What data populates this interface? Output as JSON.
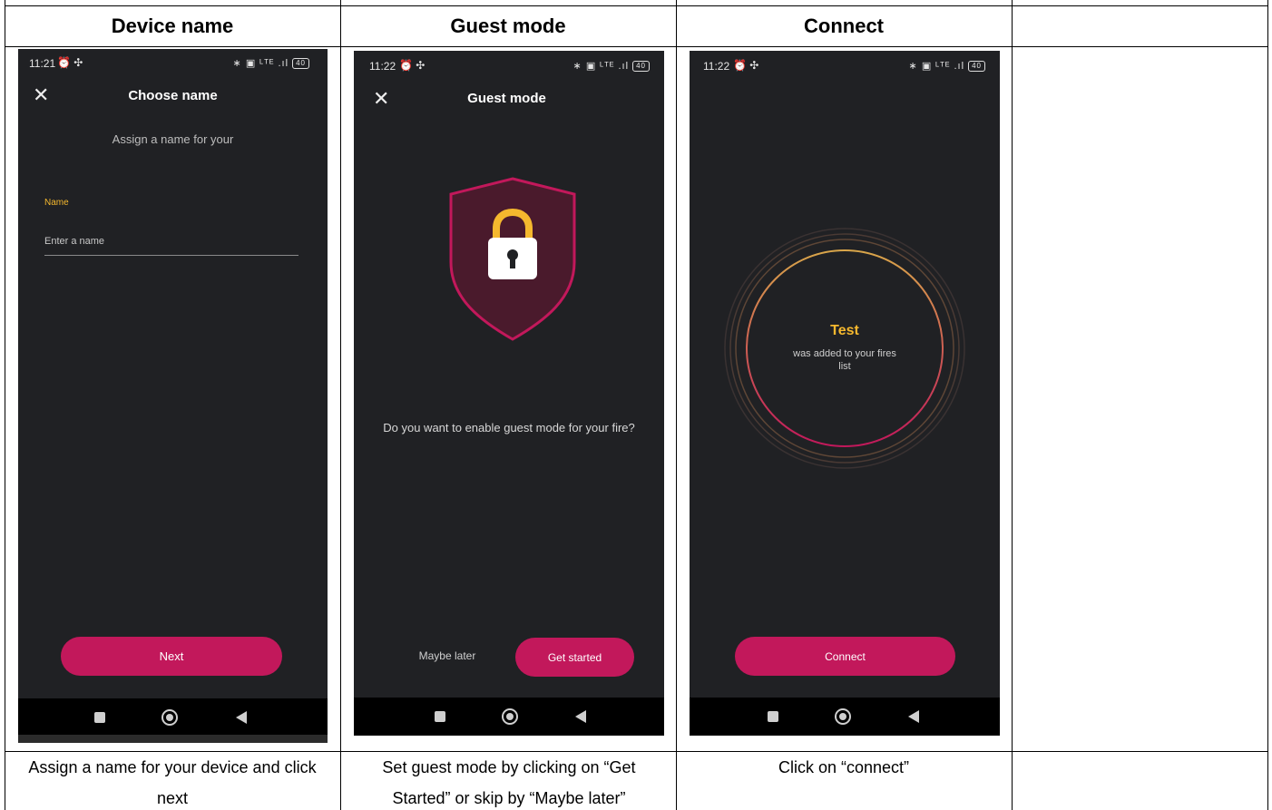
{
  "headers": [
    "Device name",
    "Guest mode",
    "Connect",
    ""
  ],
  "captions": [
    "Assign a name for your device and click next",
    "Set guest mode by clicking on “Get Started” or skip by “Maybe later”",
    "Click on “connect”",
    ""
  ],
  "screen1": {
    "time": "11:21",
    "title": "Choose name",
    "subtitle": "Assign a name for your",
    "field_label": "Name",
    "field_placeholder": "Enter a name",
    "next_label": "Next"
  },
  "screen2": {
    "time": "11:22",
    "title": "Guest mode",
    "question": "Do you want to enable guest mode for your fire?",
    "maybe_label": "Maybe later",
    "start_label": "Get started"
  },
  "screen3": {
    "time": "11:22",
    "device_name": "Test",
    "message": "was added to your fires list",
    "connect_label": "Connect"
  },
  "status": {
    "right_icons": "∗ ▣ ᴸᵀᴱ .ıl",
    "battery": "40"
  },
  "colors": {
    "accent": "#c2185b",
    "screen_bg": "#202124",
    "highlight": "#f5b82e"
  },
  "icons": [
    "close-icon",
    "shield-lock-icon",
    "alarm-icon",
    "bluetooth-icon",
    "battery-icon"
  ]
}
